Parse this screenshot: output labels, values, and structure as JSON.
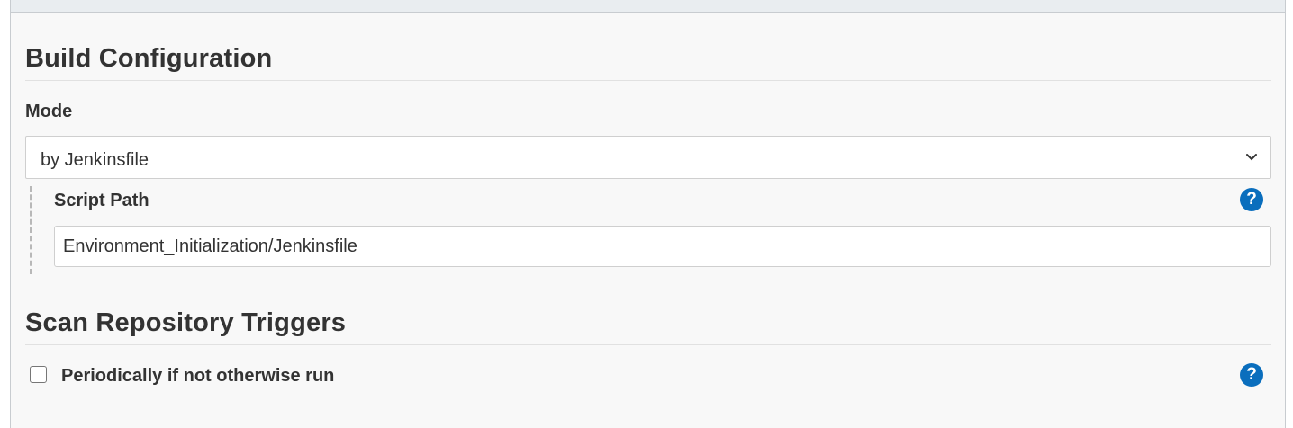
{
  "build_configuration": {
    "title": "Build Configuration",
    "mode_label": "Mode",
    "mode_value": "by Jenkinsfile",
    "script_path_label": "Script Path",
    "script_path_value": "Environment_Initialization/Jenkinsfile"
  },
  "scan_triggers": {
    "title": "Scan Repository Triggers",
    "periodic_label": "Periodically if not otherwise run",
    "periodic_checked": false
  },
  "icons": {
    "help": "?",
    "help_color": "#0a6ebd"
  }
}
